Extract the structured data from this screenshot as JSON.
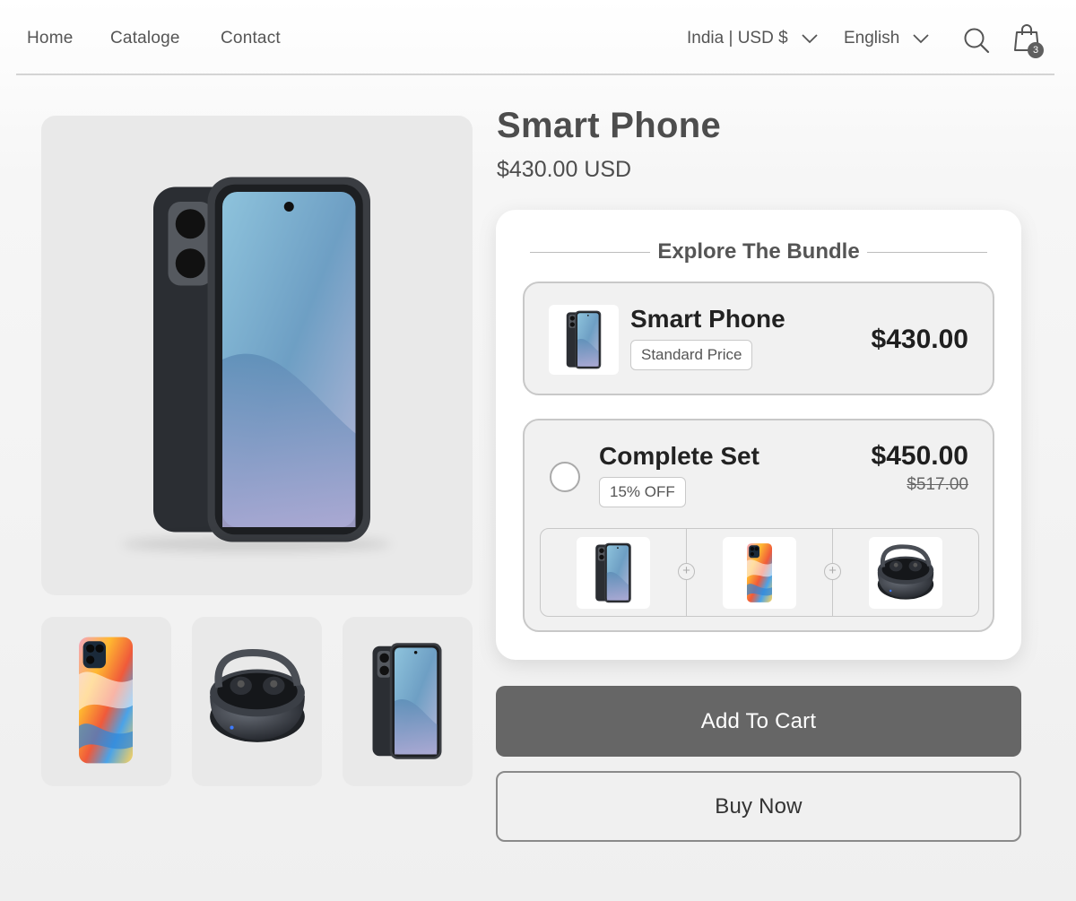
{
  "header": {
    "nav": [
      "Home",
      "Cataloge",
      "Contact"
    ],
    "region": "India | USD $",
    "language": "English",
    "cart_count": "3"
  },
  "product": {
    "title": "Smart Phone",
    "price": "$430.00 USD"
  },
  "bundle": {
    "heading": "Explore The Bundle",
    "option1": {
      "name": "Smart Phone",
      "tag": "Standard Price",
      "price": "$430.00"
    },
    "option2": {
      "name": "Complete Set",
      "tag": "15% OFF",
      "price": "$450.00",
      "old_price": "$517.00",
      "items": [
        "smartphone",
        "phone-case",
        "earbuds"
      ]
    }
  },
  "buttons": {
    "add_to_cart": "Add To Cart",
    "buy_now": "Buy Now"
  },
  "gallery": {
    "thumbnails": [
      "phone-case",
      "earbuds",
      "smartphone"
    ]
  },
  "colors": {
    "primary_button": "#666666",
    "background": "#f2f2f2",
    "card": "#ffffff"
  },
  "icons": [
    "search-icon",
    "shopping-bag-icon",
    "chevron-down-icon",
    "plus-icon"
  ]
}
